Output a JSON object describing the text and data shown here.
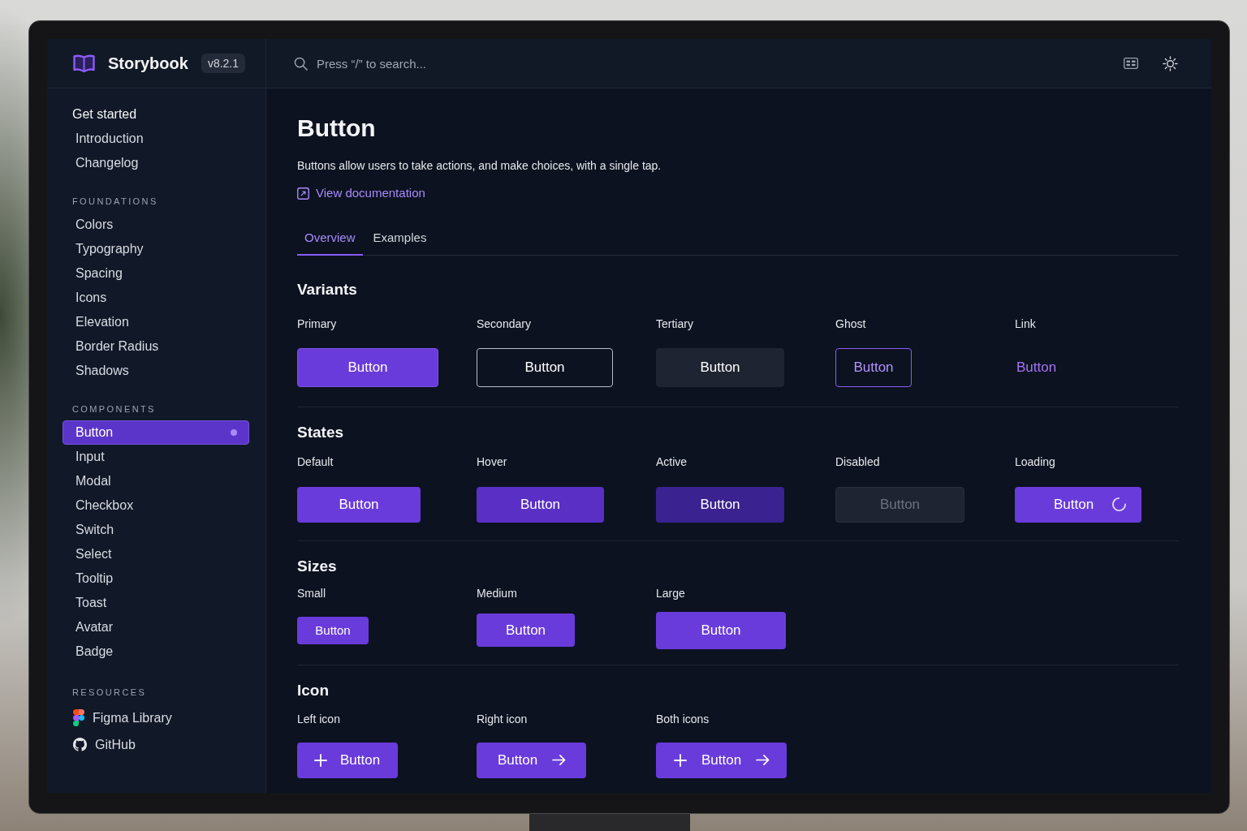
{
  "app": {
    "name": "Storybook",
    "version": "v8.2.1"
  },
  "search": {
    "placeholder": "Press “/” to search..."
  },
  "sidebar": {
    "sections": [
      {
        "kind": "title",
        "title": "Get started",
        "items": [
          {
            "label": "Introduction",
            "selected": false
          },
          {
            "label": "Changelog",
            "selected": false
          }
        ]
      },
      {
        "kind": "category",
        "title": "FOUNDATIONS",
        "items": [
          {
            "label": "Colors",
            "selected": false
          },
          {
            "label": "Typography",
            "selected": false
          },
          {
            "label": "Spacing",
            "selected": false
          },
          {
            "label": "Icons",
            "selected": false
          },
          {
            "label": "Elevation",
            "selected": false
          },
          {
            "label": "Border Radius",
            "selected": false
          },
          {
            "label": "Shadows",
            "selected": false
          }
        ]
      },
      {
        "kind": "category",
        "title": "COMPONENTS",
        "items": [
          {
            "label": "Button",
            "selected": true
          },
          {
            "label": "Input",
            "selected": false
          },
          {
            "label": "Modal",
            "selected": false
          },
          {
            "label": "Checkbox",
            "selected": false
          },
          {
            "label": "Switch",
            "selected": false
          },
          {
            "label": "Select",
            "selected": false
          },
          {
            "label": "Tooltip",
            "selected": false
          },
          {
            "label": "Toast",
            "selected": false
          },
          {
            "label": "Avatar",
            "selected": false
          },
          {
            "label": "Badge",
            "selected": false
          }
        ]
      },
      {
        "kind": "links",
        "title": "RESOURCES",
        "items": [
          {
            "label": "Figma Library",
            "selected": false
          },
          {
            "label": "GitHub",
            "selected": false
          }
        ]
      }
    ]
  },
  "page": {
    "title": "Button",
    "description": "Buttons allow users to take actions, and make choices, with a single tap.",
    "doc_link": "View documentation",
    "tabs": [
      {
        "label": "Overview",
        "selected": true
      },
      {
        "label": "Examples",
        "selected": false
      }
    ],
    "sections": [
      {
        "title": "Variants",
        "items": [
          {
            "label": "Primary",
            "kind": "primary",
            "button": "Button"
          },
          {
            "label": "Secondary",
            "kind": "secondary",
            "button": "Button"
          },
          {
            "label": "Tertiary",
            "kind": "tertiary",
            "button": "Button"
          },
          {
            "label": "Ghost",
            "kind": "ghost",
            "button": "Button"
          },
          {
            "label": "Link",
            "kind": "link",
            "button": "Button"
          }
        ]
      },
      {
        "title": "States",
        "items": [
          {
            "label": "Default",
            "kind": "default",
            "button": "Button"
          },
          {
            "label": "Hover",
            "kind": "hover",
            "button": "Button"
          },
          {
            "label": "Active",
            "kind": "active",
            "button": "Button"
          },
          {
            "label": "Disabled",
            "kind": "disabled",
            "button": "Button"
          },
          {
            "label": "Loading",
            "kind": "loading",
            "button": "Button"
          }
        ]
      },
      {
        "title": "Sizes",
        "items": [
          {
            "label": "Small",
            "kind": "small",
            "button": "Button"
          },
          {
            "label": "Medium",
            "kind": "medium",
            "button": "Button"
          },
          {
            "label": "Large",
            "kind": "large",
            "button": "Button"
          }
        ]
      },
      {
        "title": "Icon",
        "items": [
          {
            "label": "Left icon",
            "kind": "leading",
            "button": "Button"
          },
          {
            "label": "Right icon",
            "kind": "trailing",
            "button": "Button"
          },
          {
            "label": "Both icons",
            "kind": "both",
            "button": "Button"
          }
        ]
      }
    ]
  }
}
